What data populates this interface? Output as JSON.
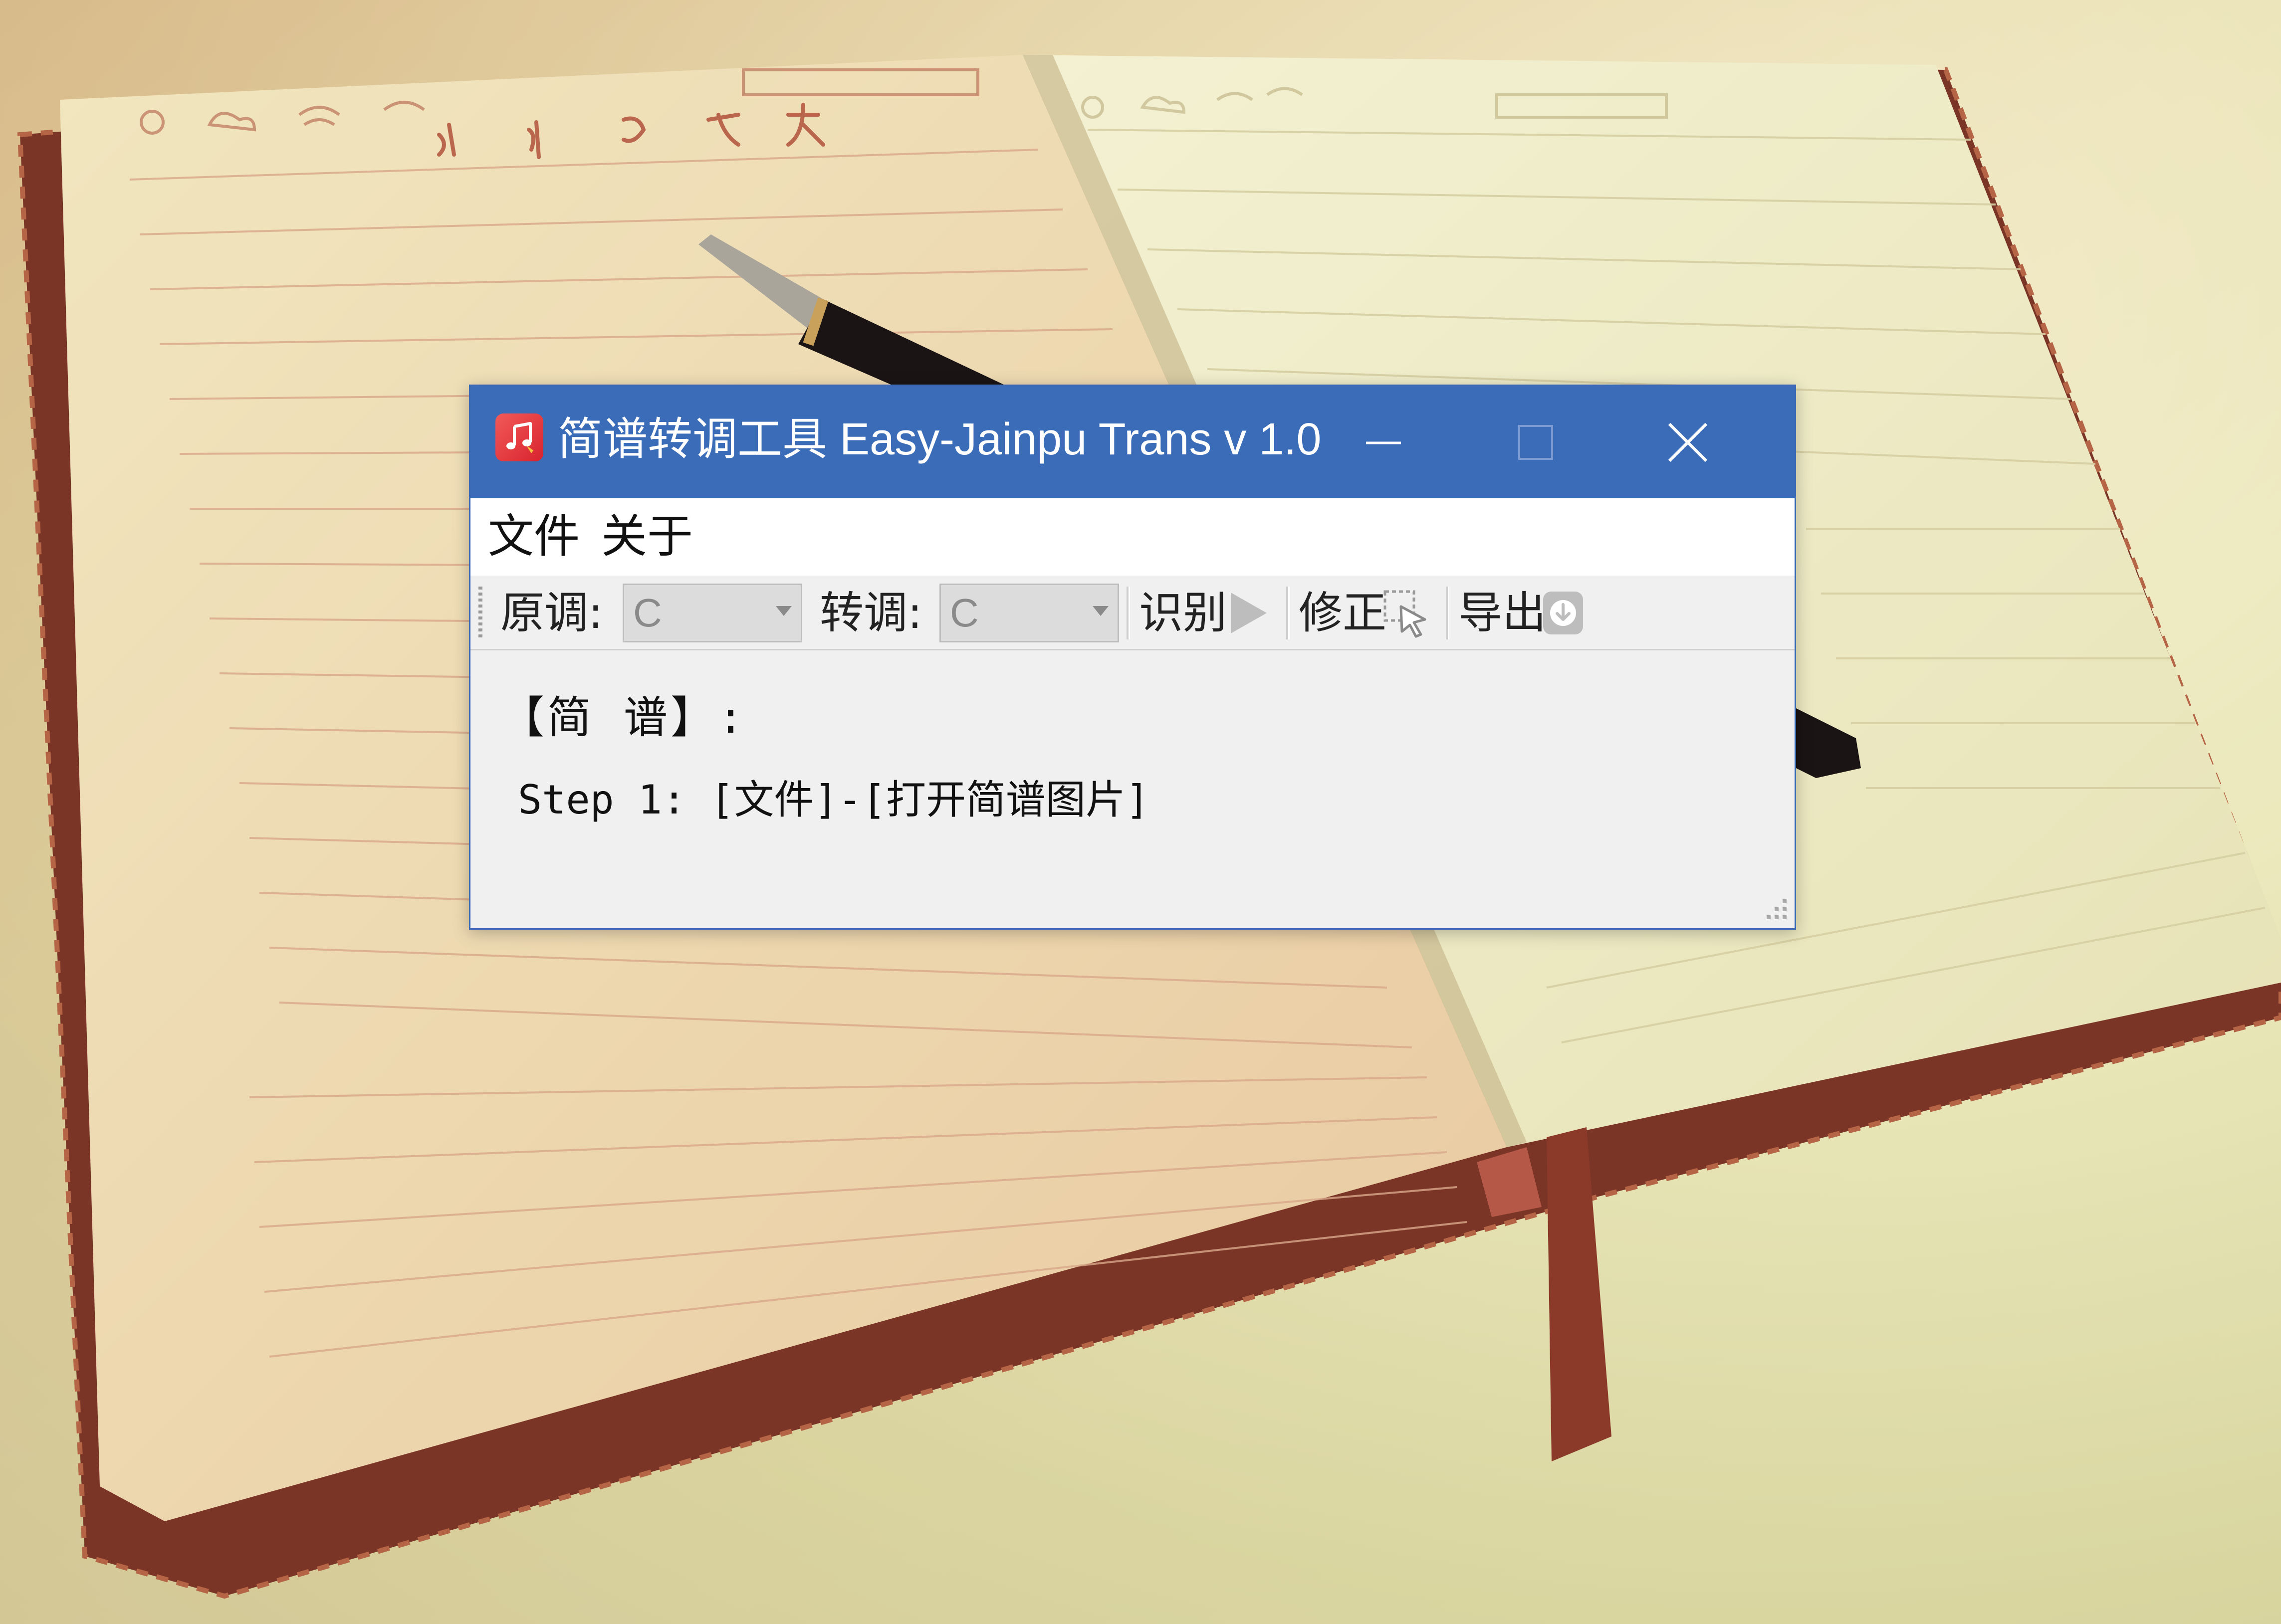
{
  "window": {
    "title": "简谱转调工具 Easy-Jainpu Trans v 1.0",
    "icon": "music-note-icon",
    "controls": {
      "minimize_icon": "minimize-icon",
      "maximize_icon": "maximize-icon",
      "close_icon": "close-icon"
    },
    "title_bar_color": "#3b6cb8"
  },
  "menu": {
    "file": "文件",
    "about": "关于"
  },
  "toolbar": {
    "original_key_label": "原调:",
    "original_key_value": "C",
    "transpose_key_label": "转调:",
    "transpose_key_value": "C",
    "recognize_label": "识别",
    "recognize_icon": "play-icon",
    "correct_label": "修正",
    "correct_icon": "cursor-select-icon",
    "export_label": "导出",
    "export_icon": "download-icon"
  },
  "content": {
    "heading": "【简 谱】:",
    "step1": "Step 1: [文件]-[打开简谱图片]"
  }
}
